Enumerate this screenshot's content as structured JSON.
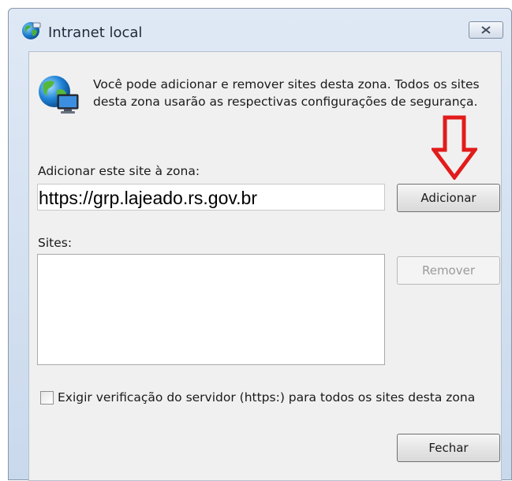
{
  "window": {
    "title": "Intranet local",
    "close_label": "Fechar janela"
  },
  "description": "Você pode adicionar e remover sites desta zona. Todos os sites desta zona usarão as respectivas configurações de segurança.",
  "add_site": {
    "label": "Adicionar este site à zona:",
    "value": "https://grp.lajeado.rs.gov.br",
    "button_label": "Adicionar"
  },
  "sites": {
    "label": "Sites:",
    "items": [],
    "remove_label": "Remover"
  },
  "https_check": {
    "label": "Exigir verificação do servidor (https:) para todos os sites desta zona",
    "checked": false
  },
  "footer": {
    "close_label": "Fechar"
  },
  "annotation": {
    "arrow_color": "#e21b1b",
    "icon": "arrow-down-icon"
  }
}
